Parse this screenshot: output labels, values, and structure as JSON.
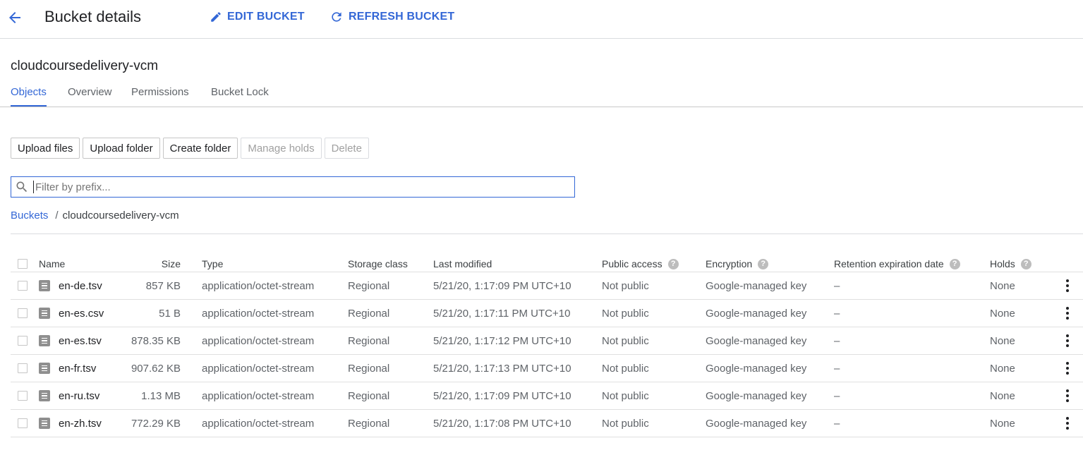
{
  "header": {
    "title": "Bucket details",
    "edit_label": "EDIT BUCKET",
    "refresh_label": "REFRESH BUCKET"
  },
  "bucket_name": "cloudcoursedelivery-vcm",
  "tabs": [
    {
      "label": "Objects",
      "active": true
    },
    {
      "label": "Overview",
      "active": false
    },
    {
      "label": "Permissions",
      "active": false
    },
    {
      "label": "Bucket Lock",
      "active": false
    }
  ],
  "toolbar": {
    "upload_files": "Upload files",
    "upload_folder": "Upload folder",
    "create_folder": "Create folder",
    "manage_holds": "Manage holds",
    "delete": "Delete"
  },
  "filter": {
    "placeholder": "Filter by prefix..."
  },
  "breadcrumb": {
    "root": "Buckets",
    "separator": "/",
    "current": "cloudcoursedelivery-vcm"
  },
  "table": {
    "columns": {
      "name": "Name",
      "size": "Size",
      "type": "Type",
      "storage_class": "Storage class",
      "last_modified": "Last modified",
      "public_access": "Public access",
      "encryption": "Encryption",
      "retention": "Retention expiration date",
      "holds": "Holds"
    },
    "help_glyph": "?",
    "rows": [
      {
        "name": "en-de.tsv",
        "size": "857 KB",
        "type": "application/octet-stream",
        "storage_class": "Regional",
        "last_modified": "5/21/20, 1:17:09 PM UTC+10",
        "public_access": "Not public",
        "encryption": "Google-managed key",
        "retention": "–",
        "holds": "None"
      },
      {
        "name": "en-es.csv",
        "size": "51 B",
        "type": "application/octet-stream",
        "storage_class": "Regional",
        "last_modified": "5/21/20, 1:17:11 PM UTC+10",
        "public_access": "Not public",
        "encryption": "Google-managed key",
        "retention": "–",
        "holds": "None"
      },
      {
        "name": "en-es.tsv",
        "size": "878.35 KB",
        "type": "application/octet-stream",
        "storage_class": "Regional",
        "last_modified": "5/21/20, 1:17:12 PM UTC+10",
        "public_access": "Not public",
        "encryption": "Google-managed key",
        "retention": "–",
        "holds": "None"
      },
      {
        "name": "en-fr.tsv",
        "size": "907.62 KB",
        "type": "application/octet-stream",
        "storage_class": "Regional",
        "last_modified": "5/21/20, 1:17:13 PM UTC+10",
        "public_access": "Not public",
        "encryption": "Google-managed key",
        "retention": "–",
        "holds": "None"
      },
      {
        "name": "en-ru.tsv",
        "size": "1.13 MB",
        "type": "application/octet-stream",
        "storage_class": "Regional",
        "last_modified": "5/21/20, 1:17:09 PM UTC+10",
        "public_access": "Not public",
        "encryption": "Google-managed key",
        "retention": "–",
        "holds": "None"
      },
      {
        "name": "en-zh.tsv",
        "size": "772.29 KB",
        "type": "application/octet-stream",
        "storage_class": "Regional",
        "last_modified": "5/21/20, 1:17:08 PM UTC+10",
        "public_access": "Not public",
        "encryption": "Google-managed key",
        "retention": "–",
        "holds": "None"
      }
    ]
  },
  "colors": {
    "accent": "#3367d6",
    "text": "#3c4043",
    "muted": "#5f6368",
    "border": "#dadce0"
  },
  "icons": [
    "arrow-back-icon",
    "pencil-icon",
    "refresh-icon",
    "search-icon",
    "file-icon",
    "help-icon",
    "more-vert-icon"
  ]
}
